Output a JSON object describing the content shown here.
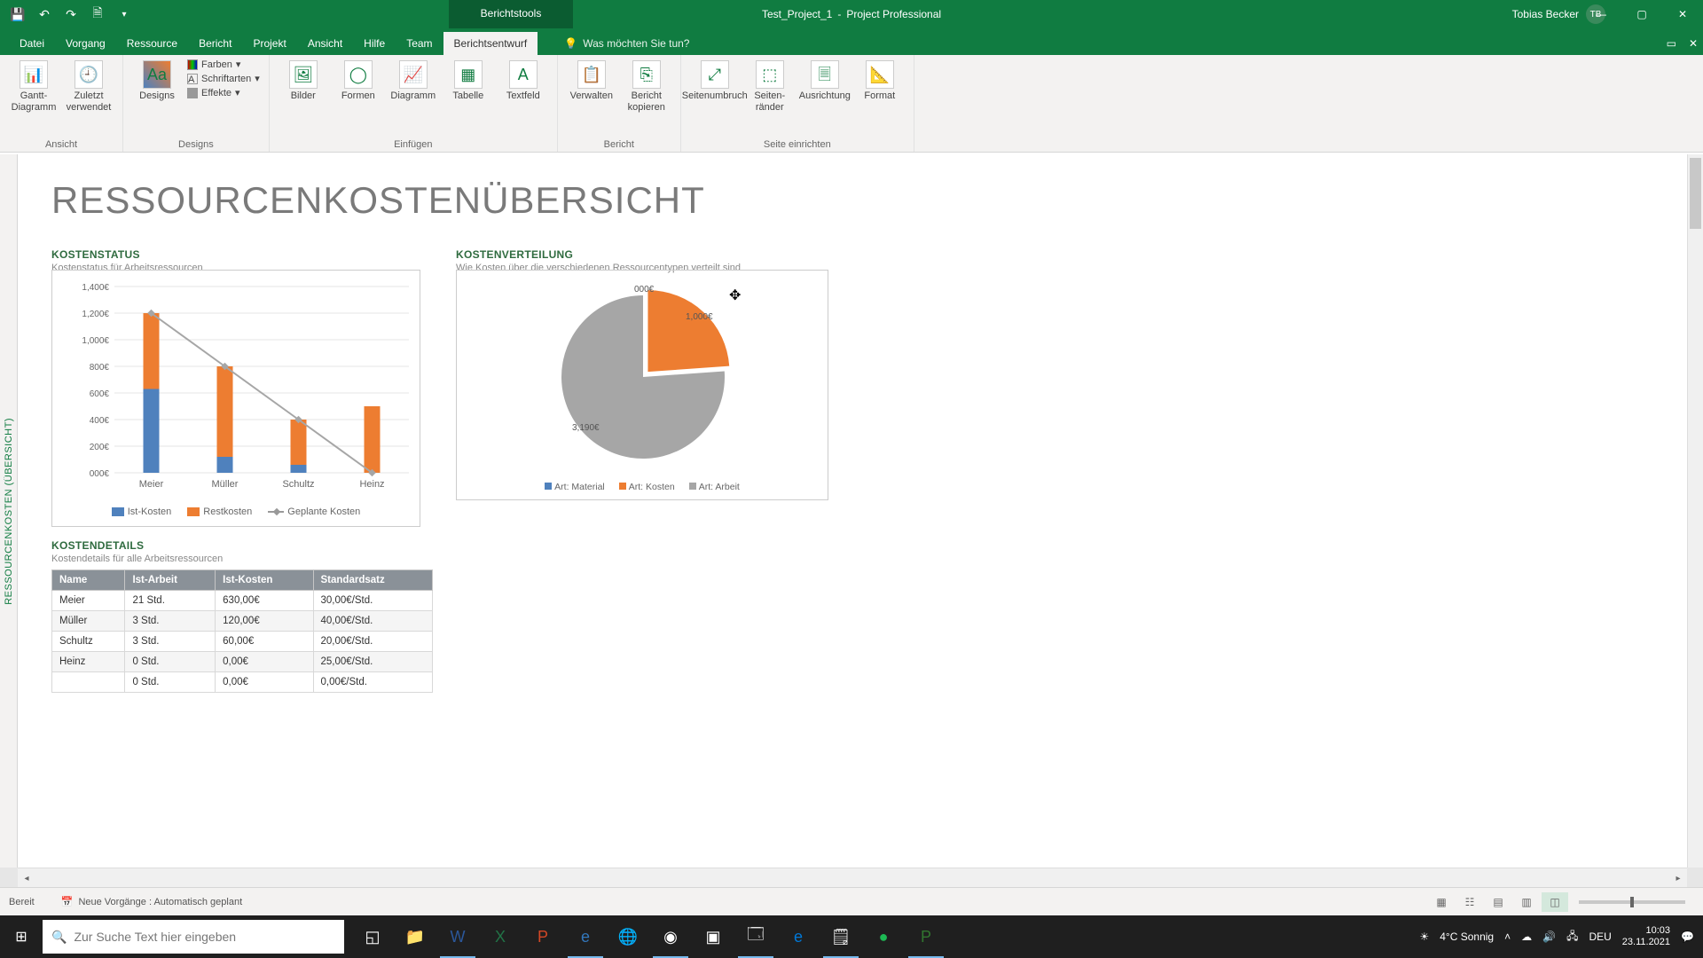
{
  "app": {
    "tool_tab": "Berichtstools",
    "doc_name": "Test_Project_1",
    "app_name": "Project Professional",
    "user_name": "Tobias Becker",
    "user_initials": "TB"
  },
  "tabs": {
    "datei": "Datei",
    "vorgang": "Vorgang",
    "ressource": "Ressource",
    "bericht": "Bericht",
    "projekt": "Projekt",
    "ansicht": "Ansicht",
    "hilfe": "Hilfe",
    "team": "Team",
    "berichtsentwurf": "Berichtsentwurf",
    "tellme": "Was möchten Sie tun?"
  },
  "ribbon": {
    "ansicht": {
      "gantt": "Gantt-Diagramm",
      "zuletzt": "Zuletzt verwendet",
      "label": "Ansicht"
    },
    "designs": {
      "designs": "Designs",
      "farben": "Farben",
      "schriftarten": "Schriftarten",
      "effekte": "Effekte",
      "label": "Designs"
    },
    "einfuegen": {
      "bilder": "Bilder",
      "formen": "Formen",
      "diagramm": "Diagramm",
      "tabelle": "Tabelle",
      "textfeld": "Textfeld",
      "label": "Einfügen"
    },
    "bericht": {
      "verwalten": "Verwalten",
      "kopieren": "Bericht kopieren",
      "label": "Bericht"
    },
    "seite": {
      "umbruch": "Seitenumbruch",
      "raender": "Seiten-ränder",
      "ausrichtung": "Ausrichtung",
      "format": "Format",
      "label": "Seite einrichten"
    }
  },
  "report": {
    "side_label": "RESSOURCENKOSTEN (ÜBERSICHT)",
    "title": "RESSOURCENKOSTENÜBERSICHT",
    "kostenstatus": {
      "h": "KOSTENSTATUS",
      "sub": "Kostenstatus für Arbeitsressourcen"
    },
    "kostenverteilung": {
      "h": "KOSTENVERTEILUNG",
      "sub": "Wie Kosten über die verschiedenen Ressourcentypen verteilt sind"
    },
    "kostendetails": {
      "h": "KOSTENDETAILS",
      "sub": "Kostendetails für alle Arbeitsressourcen"
    }
  },
  "chart_data": [
    {
      "type": "bar",
      "title": "Kostenstatus",
      "categories": [
        "Meier",
        "Müller",
        "Schultz",
        "Heinz"
      ],
      "series": [
        {
          "name": "Ist-Kosten",
          "type": "bar",
          "color": "#4f81bd",
          "values": [
            630,
            120,
            60,
            0
          ]
        },
        {
          "name": "Restkosten",
          "type": "bar",
          "color": "#ed7d31",
          "values": [
            570,
            680,
            340,
            500
          ]
        },
        {
          "name": "Geplante Kosten",
          "type": "line",
          "color": "#a6a6a6",
          "values": [
            1200,
            800,
            400,
            0
          ]
        }
      ],
      "yticks": [
        "000€",
        "200€",
        "400€",
        "600€",
        "800€",
        "1,000€",
        "1,200€",
        "1,400€"
      ],
      "ylim": [
        0,
        1400
      ]
    },
    {
      "type": "pie",
      "title": "Kostenverteilung",
      "series": [
        {
          "name": "Art: Material",
          "color": "#4f81bd",
          "value": 0,
          "label": "000€"
        },
        {
          "name": "Art: Kosten",
          "color": "#ed7d31",
          "value": 1000,
          "label": "1,000€"
        },
        {
          "name": "Art: Arbeit",
          "color": "#a6a6a6",
          "value": 3190,
          "label": "3,190€"
        }
      ]
    }
  ],
  "bar_legend": {
    "ist": "Ist-Kosten",
    "rest": "Restkosten",
    "geplant": "Geplante Kosten"
  },
  "pie_legend": {
    "material": "Art: Material",
    "kosten": "Art: Kosten",
    "arbeit": "Art: Arbeit"
  },
  "pie_labels": {
    "material": "000€",
    "kosten": "1,000€",
    "arbeit": "3,190€"
  },
  "table": {
    "cols": {
      "name": "Name",
      "ist_arbeit": "Ist-Arbeit",
      "ist_kosten": "Ist-Kosten",
      "satz": "Standardsatz"
    },
    "rows": [
      {
        "name": "Meier",
        "arbeit": "21 Std.",
        "kosten": "630,00€",
        "satz": "30,00€/Std."
      },
      {
        "name": "Müller",
        "arbeit": "3 Std.",
        "kosten": "120,00€",
        "satz": "40,00€/Std."
      },
      {
        "name": "Schultz",
        "arbeit": "3 Std.",
        "kosten": "60,00€",
        "satz": "20,00€/Std."
      },
      {
        "name": "Heinz",
        "arbeit": "0 Std.",
        "kosten": "0,00€",
        "satz": "25,00€/Std."
      },
      {
        "name": "",
        "arbeit": "0 Std.",
        "kosten": "0,00€",
        "satz": "0,00€/Std."
      }
    ]
  },
  "status": {
    "ready": "Bereit",
    "schedule": "Neue Vorgänge : Automatisch geplant"
  },
  "taskbar": {
    "search_placeholder": "Zur Suche Text hier eingeben",
    "weather": "4°C  Sonnig",
    "lang": "DEU",
    "time": "10:03",
    "date": "23.11.2021"
  }
}
